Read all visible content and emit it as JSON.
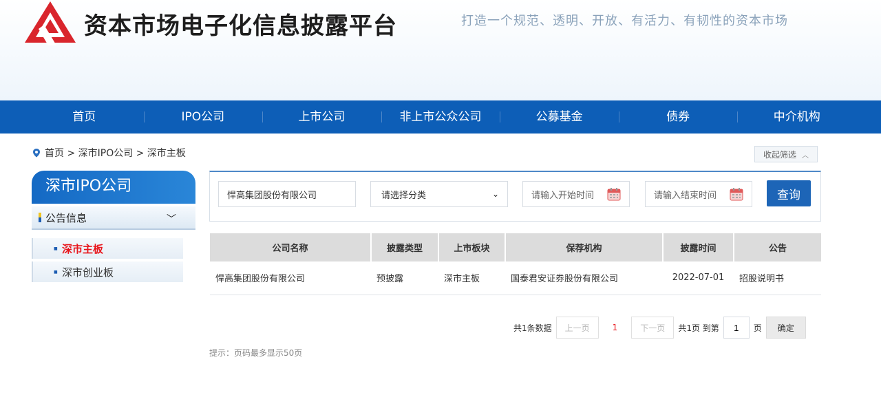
{
  "header": {
    "site_title": "资本市场电子化信息披露平台",
    "slogan": "打造一个规范、透明、开放、有活力、有韧性的资本市场"
  },
  "nav": {
    "items": [
      "首页",
      "IPO公司",
      "上市公司",
      "非上市公众公司",
      "公募基金",
      "债券",
      "中介机构"
    ]
  },
  "breadcrumb": {
    "text": "首页 > 深市IPO公司 > 深市主板"
  },
  "collapse_filter": {
    "label": "收起筛选"
  },
  "sidebar": {
    "title": "深市IPO公司",
    "dropdown": "公告信息",
    "items": [
      {
        "label": "深市主板",
        "active": true
      },
      {
        "label": "深市创业板",
        "active": false
      }
    ]
  },
  "filters": {
    "company_value": "悍高集团股份有限公司",
    "category_placeholder": "请选择分类",
    "start_placeholder": "请输入开始时间",
    "end_placeholder": "请输入结束时间",
    "query_label": "查询"
  },
  "table": {
    "headers": [
      "公司名称",
      "披露类型",
      "上市板块",
      "保荐机构",
      "披露时间",
      "公告"
    ],
    "rows": [
      [
        "悍高集团股份有限公司",
        "预披露",
        "深市主板",
        "国泰君安证券股份有限公司",
        "2022-07-01",
        "招股说明书"
      ]
    ]
  },
  "pagination": {
    "total": "共1条数据",
    "prev": "上一页",
    "current": "1",
    "next": "下一页",
    "pages_text": "共1页 到第",
    "page_input": "1",
    "page_suffix": "页",
    "confirm": "确定"
  },
  "tip": "提示：页码最多显示50页",
  "colors": {
    "nav_bg": "#0d5eb7",
    "accent_red": "#e8161c",
    "query_btn": "#1d65b7"
  }
}
